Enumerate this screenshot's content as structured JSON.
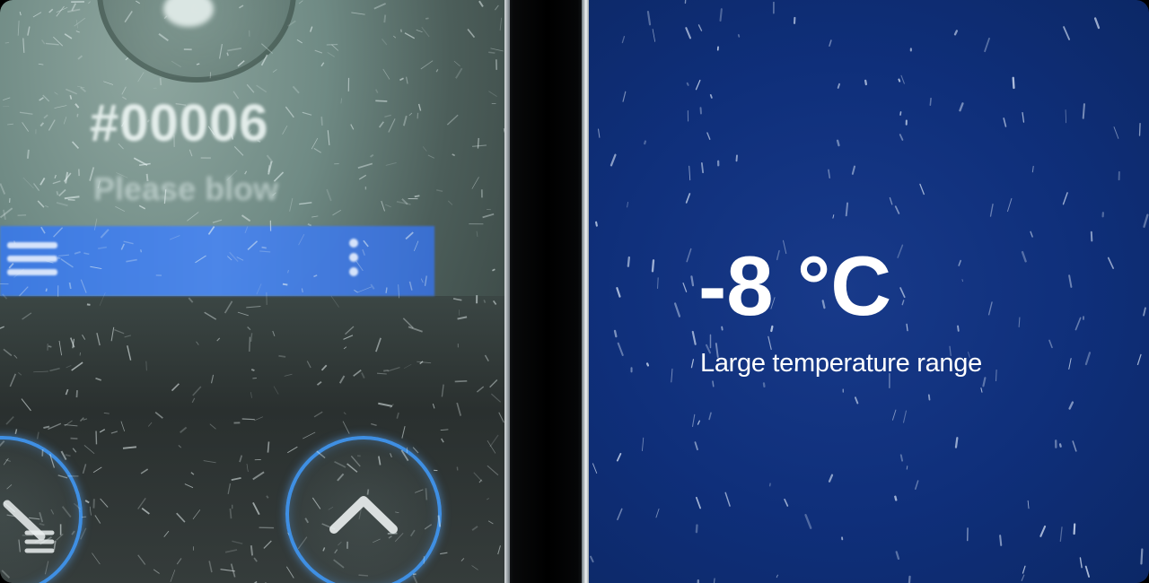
{
  "device_screen": {
    "ticket_number": "#00006",
    "hint_text": "Please blow",
    "icons": {
      "menu": "menu-icon",
      "more": "kebab-menu-icon",
      "edit_list": "edit-list-icon",
      "up": "chevron-up-icon"
    }
  },
  "info_panel": {
    "temperature": "-8 °C",
    "caption": "Large temperature range"
  },
  "colors": {
    "panel_blue": "#0f2f7a",
    "bar_blue": "#4a86ee",
    "ring_blue": "#3f8fe3",
    "text_white": "#ffffff"
  }
}
